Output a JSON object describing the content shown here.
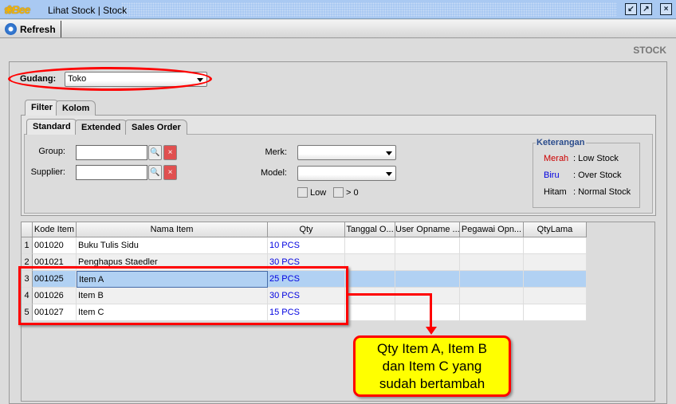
{
  "window": {
    "logo": "Bee",
    "title": "Lihat Stock | Stock"
  },
  "toolbar": {
    "refresh_label": "Refresh"
  },
  "page": {
    "heading": "STOCK"
  },
  "gudang": {
    "label": "Gudang:",
    "value": "Toko"
  },
  "tabs": [
    {
      "label": "Filter"
    },
    {
      "label": "Kolom"
    }
  ],
  "subtabs": [
    {
      "label": "Standard"
    },
    {
      "label": "Extended"
    },
    {
      "label": "Sales Order"
    }
  ],
  "filter": {
    "group_label": "Group:",
    "group_value": "",
    "supplier_label": "Supplier:",
    "supplier_value": "",
    "merk_label": "Merk:",
    "merk_value": "",
    "model_label": "Model:",
    "model_value": "",
    "low_label": "Low",
    "gt0_label": "> 0"
  },
  "legend": {
    "title": "Keterangan",
    "items": [
      {
        "name": "Merah",
        "desc": ": Low Stock",
        "color": "#cc0000"
      },
      {
        "name": "Biru",
        "desc": ": Over Stock",
        "color": "#0000e0"
      },
      {
        "name": "Hitam",
        "desc": ": Normal Stock",
        "color": "#000000"
      }
    ]
  },
  "table": {
    "columns": [
      "Kode Item",
      "Nama Item",
      "Qty",
      "Tanggal O...",
      "User Opname ...",
      "Pegawai Opn...",
      "QtyLama"
    ],
    "rows": [
      {
        "n": "1",
        "kode": "001020",
        "nama": "Buku Tulis Sidu",
        "qty": "10 PCS"
      },
      {
        "n": "2",
        "kode": "001021",
        "nama": "Penghapus Staedler",
        "qty": "30 PCS"
      },
      {
        "n": "3",
        "kode": "001025",
        "nama": "Item A",
        "qty": "25 PCS"
      },
      {
        "n": "4",
        "kode": "001026",
        "nama": "Item B",
        "qty": "30 PCS"
      },
      {
        "n": "5",
        "kode": "001027",
        "nama": "Item C",
        "qty": "15 PCS"
      }
    ],
    "selected_row": 3
  },
  "callout": {
    "text": "Qty Item A, Item B dan Item C yang sudah bertambah"
  }
}
